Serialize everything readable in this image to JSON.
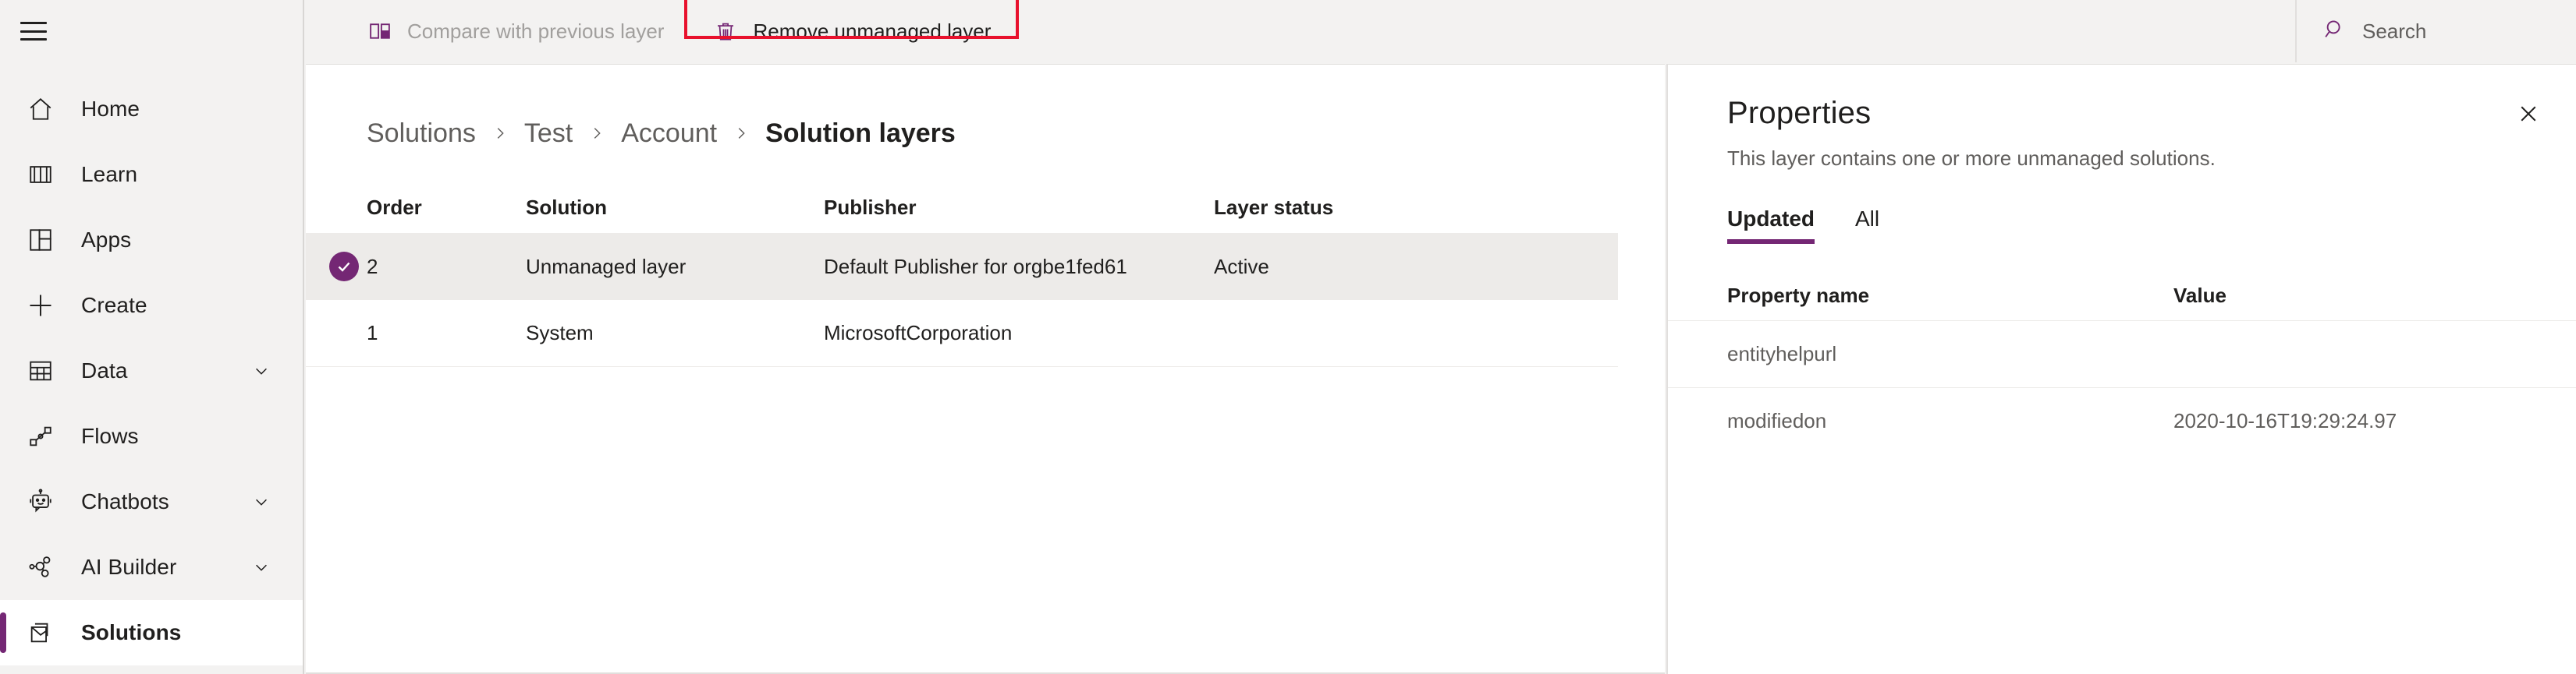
{
  "sidebar": {
    "menu_icon": "hamburger-icon",
    "items": [
      {
        "label": "Home",
        "icon": "home-icon",
        "chevron": false,
        "selected": false
      },
      {
        "label": "Learn",
        "icon": "book-icon",
        "chevron": false,
        "selected": false
      },
      {
        "label": "Apps",
        "icon": "apps-grid-icon",
        "chevron": false,
        "selected": false
      },
      {
        "label": "Create",
        "icon": "plus-icon",
        "chevron": false,
        "selected": false
      },
      {
        "label": "Data",
        "icon": "table-icon",
        "chevron": true,
        "selected": false
      },
      {
        "label": "Flows",
        "icon": "flow-icon",
        "chevron": false,
        "selected": false
      },
      {
        "label": "Chatbots",
        "icon": "robot-icon",
        "chevron": true,
        "selected": false
      },
      {
        "label": "AI Builder",
        "icon": "ai-builder-icon",
        "chevron": true,
        "selected": false
      },
      {
        "label": "Solutions",
        "icon": "solutions-icon",
        "chevron": false,
        "selected": true
      }
    ]
  },
  "commandbar": {
    "compare_label": "Compare with previous layer",
    "compare_icon": "compare-layers-icon",
    "compare_disabled": true,
    "remove_label": "Remove unmanaged layer",
    "remove_icon": "trash-icon",
    "highlight_color": "#e8112d",
    "search_label": "Search",
    "search_icon": "search-icon"
  },
  "main": {
    "breadcrumb": [
      {
        "label": "Solutions",
        "current": false
      },
      {
        "label": "Test",
        "current": false
      },
      {
        "label": "Account",
        "current": false
      },
      {
        "label": "Solution layers",
        "current": true
      }
    ],
    "table": {
      "columns": [
        "Order",
        "Solution",
        "Publisher",
        "Layer status"
      ],
      "rows": [
        {
          "selected": true,
          "order": "2",
          "solution": "Unmanaged layer",
          "publisher": "Default Publisher for orgbe1fed61",
          "status": "Active"
        },
        {
          "selected": false,
          "order": "1",
          "solution": "System",
          "publisher": "MicrosoftCorporation",
          "status": ""
        }
      ]
    }
  },
  "properties": {
    "title": "Properties",
    "subtitle": "This layer contains one or more unmanaged solutions.",
    "close_icon": "close-icon",
    "tabs": [
      {
        "label": "Updated",
        "active": true
      },
      {
        "label": "All",
        "active": false
      }
    ],
    "columns": [
      "Property name",
      "Value"
    ],
    "rows": [
      {
        "name": "entityhelpurl",
        "value": ""
      },
      {
        "name": "modifiedon",
        "value": "2020-10-16T19:29:24.97"
      }
    ]
  },
  "theme": {
    "accent": "#742774",
    "sidebar_bg": "#f3f2f1",
    "selected_row_bg": "#edebe9",
    "muted_text": "#605e5c",
    "text": "#201f1e"
  }
}
